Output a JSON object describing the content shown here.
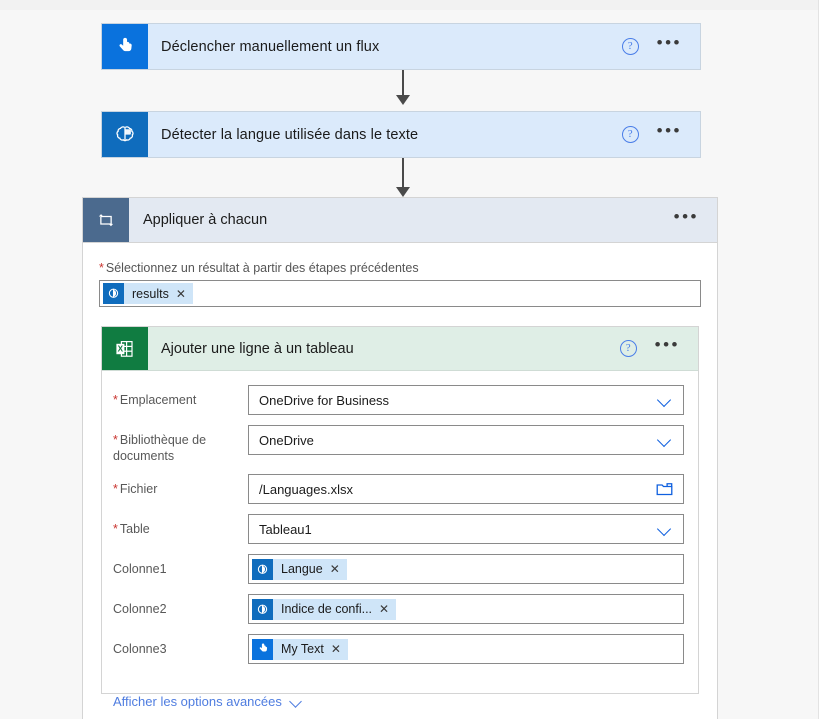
{
  "flow": {
    "trigger": {
      "title": "Déclencher manuellement un flux",
      "icon": "tap-hand-icon",
      "help_label": "?",
      "menu_label": "•••",
      "bg": "#dbeafb",
      "icon_bg": "#0a72dd"
    },
    "action_detect": {
      "title": "Détecter la langue utilisée dans le texte",
      "icon": "brain-icon",
      "help_label": "?",
      "menu_label": "•••",
      "bg": "#dbeafb",
      "icon_bg": "#0f6cbd"
    },
    "loop": {
      "title": "Appliquer à chacun",
      "icon": "loop-icon",
      "menu_label": "•••",
      "icon_bg": "#4b6a8e",
      "header_bg": "#e3e9f2",
      "select_field": {
        "required_marker": "*",
        "label": "Sélectionnez un résultat à partir des étapes précédentes",
        "token": {
          "icon": "brain-icon",
          "text": "results",
          "remove_label": "✕"
        }
      }
    },
    "excel_action": {
      "title": "Ajouter une ligne à un tableau",
      "icon": "excel-icon",
      "icon_bg": "#107c41",
      "header_bg": "#dfeee6",
      "help_label": "?",
      "menu_label": "•••",
      "fields": [
        {
          "label": "Emplacement",
          "required": true,
          "required_marker": "*",
          "type": "dropdown",
          "value": "OneDrive for Business"
        },
        {
          "label": "Bibliothèque de documents",
          "required": true,
          "required_marker": "*",
          "type": "dropdown",
          "value": "OneDrive"
        },
        {
          "label": "Fichier",
          "required": true,
          "required_marker": "*",
          "type": "file-picker",
          "value": "/Languages.xlsx",
          "picker_icon": "folder-icon"
        },
        {
          "label": "Table",
          "required": true,
          "required_marker": "*",
          "type": "dropdown",
          "value": "Tableau1"
        },
        {
          "label": "Colonne1",
          "required": false,
          "type": "token",
          "token": {
            "icon": "brain-icon",
            "text": "Langue",
            "remove_label": "✕"
          }
        },
        {
          "label": "Colonne2",
          "required": false,
          "type": "token",
          "token": {
            "icon": "brain-icon",
            "text": "Indice de confi...",
            "remove_label": "✕"
          }
        },
        {
          "label": "Colonne3",
          "required": false,
          "type": "token",
          "token": {
            "icon": "tap-hand-icon",
            "text": "My Text",
            "remove_label": "✕"
          }
        }
      ],
      "advanced_link": {
        "label": "Afficher les options avancées",
        "icon": "chevron-down-icon"
      }
    }
  },
  "colors": {
    "accent_blue": "#0a72dd",
    "excel_green": "#107c41",
    "loop_slate": "#4b6a8e",
    "token_chip": "#cfe5f8",
    "required_red": "#c9332e",
    "link_blue": "#4f7de0",
    "page_bg": "#f7f7f7"
  }
}
